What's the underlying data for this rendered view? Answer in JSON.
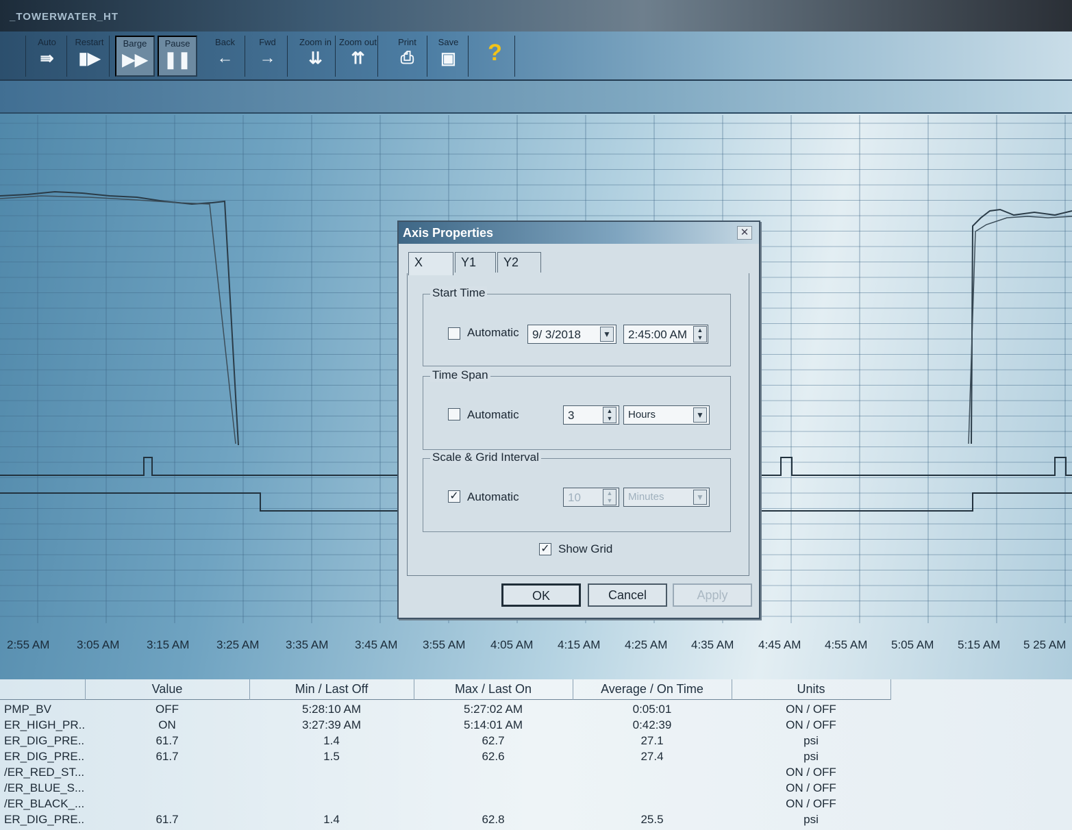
{
  "window": {
    "title": "_TOWERWATER_HT"
  },
  "toolbar": {
    "buttons": [
      {
        "label": "Auto",
        "icon": "step-forward-icon",
        "glyph": "⇛"
      },
      {
        "label": "Restart",
        "icon": "restart-icon",
        "glyph": "▮▶"
      },
      {
        "label": "Barge",
        "icon": "fast-forward-icon",
        "glyph": "▶▶"
      },
      {
        "label": "Pause",
        "icon": "pause-icon",
        "glyph": "❚❚"
      },
      {
        "label": "Back",
        "icon": "arrow-left-icon",
        "glyph": "←"
      },
      {
        "label": "Fwd",
        "icon": "arrow-right-icon",
        "glyph": "→"
      },
      {
        "label": "Zoom in",
        "icon": "zoom-in-icon",
        "glyph": "⇊"
      },
      {
        "label": "Zoom out",
        "icon": "zoom-out-icon",
        "glyph": "⇈"
      },
      {
        "label": "Print",
        "icon": "printer-icon",
        "glyph": "⎙"
      },
      {
        "label": "Save",
        "icon": "save-icon",
        "glyph": "▣"
      },
      {
        "label": "",
        "icon": "help-icon",
        "glyph": "?"
      }
    ]
  },
  "xaxis": {
    "ticks": [
      "2:55 AM",
      "3:05 AM",
      "3:15 AM",
      "3:25 AM",
      "3:35 AM",
      "3:45 AM",
      "3:55 AM",
      "4:05 AM",
      "4:15 AM",
      "4:25 AM",
      "4:35 AM",
      "4:45 AM",
      "4:55 AM",
      "5:05 AM",
      "5:15 AM",
      "5 25 AM"
    ]
  },
  "chart_data": {
    "type": "line",
    "x_ticks": [
      "2:55 AM",
      "3:05 AM",
      "3:15 AM",
      "3:25 AM",
      "3:35 AM",
      "3:45 AM",
      "3:55 AM",
      "4:05 AM",
      "4:15 AM",
      "4:25 AM",
      "4:35 AM",
      "4:45 AM",
      "4:55 AM",
      "5:05 AM",
      "5:15 AM",
      "5 25 AM"
    ],
    "grid": true
  },
  "table": {
    "headers": [
      "",
      "Value",
      "Min / Last Off",
      "Max / Last On",
      "Average / On Time",
      "Units"
    ],
    "rows": [
      {
        "name": "PMP_BV",
        "value": "OFF",
        "min": "5:28:10 AM",
        "max": "5:27:02 AM",
        "avg": "0:05:01",
        "units": "ON / OFF"
      },
      {
        "name": "ER_HIGH_PR...",
        "value": "ON",
        "min": "3:27:39 AM",
        "max": "5:14:01 AM",
        "avg": "0:42:39",
        "units": "ON / OFF"
      },
      {
        "name": "ER_DIG_PRE...",
        "value": "61.7",
        "min": "1.4",
        "max": "62.7",
        "avg": "27.1",
        "units": "psi"
      },
      {
        "name": "ER_DIG_PRE...",
        "value": "61.7",
        "min": "1.5",
        "max": "62.6",
        "avg": "27.4",
        "units": "psi"
      },
      {
        "name": "/ER_RED_ST...",
        "value": "",
        "min": "",
        "max": "",
        "avg": "",
        "units": "ON / OFF"
      },
      {
        "name": "/ER_BLUE_S...",
        "value": "",
        "min": "",
        "max": "",
        "avg": "",
        "units": "ON / OFF"
      },
      {
        "name": "/ER_BLACK_...",
        "value": "",
        "min": "",
        "max": "",
        "avg": "",
        "units": "ON / OFF"
      },
      {
        "name": "ER_DIG_PRE...",
        "value": "61.7",
        "min": "1.4",
        "max": "62.8",
        "avg": "25.5",
        "units": "psi"
      }
    ]
  },
  "dialog": {
    "title": "Axis Properties",
    "close_glyph": "✕",
    "tabs": [
      "X",
      "Y1",
      "Y2"
    ],
    "active_tab": "X",
    "start_time": {
      "group_label": "Start Time",
      "automatic_label": "Automatic",
      "automatic_checked": false,
      "date": "9/ 3/2018",
      "time": "2:45:00 AM"
    },
    "time_span": {
      "group_label": "Time Span",
      "automatic_label": "Automatic",
      "automatic_checked": false,
      "value": "3",
      "unit": "Hours"
    },
    "scale_grid": {
      "group_label": "Scale & Grid Interval",
      "automatic_label": "Automatic",
      "automatic_checked": true,
      "value": "10",
      "unit": "Minutes"
    },
    "show_grid_label": "Show Grid",
    "show_grid_checked": true,
    "ok_label": "OK",
    "cancel_label": "Cancel",
    "apply_label": "Apply"
  }
}
